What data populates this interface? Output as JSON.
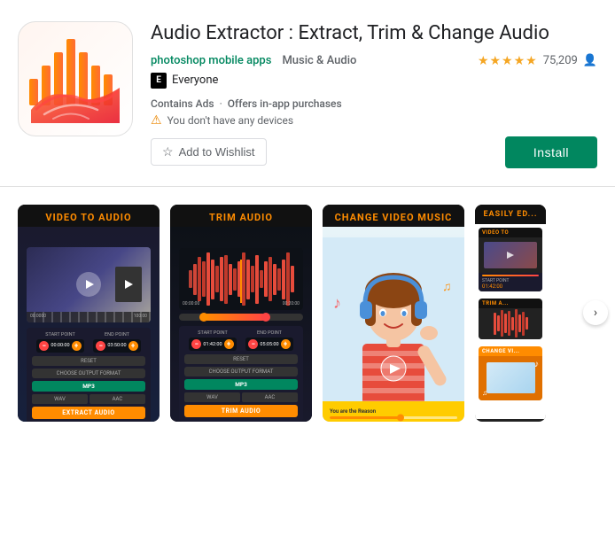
{
  "app": {
    "title": "Audio Extractor : Extract, Trim & Change Audio",
    "developer": "photoshop mobile apps",
    "category": "Music & Audio",
    "rating_stars": "★★★★★",
    "rating_count": "75,209",
    "esrb_rating": "E",
    "esrb_label": "Everyone",
    "contains_ads": "Contains Ads",
    "iap": "Offers in-app purchases",
    "device_warning": "You don't have any devices",
    "wishlist_label": "Add to Wishlist",
    "install_label": "Install"
  },
  "screenshots": [
    {
      "label": "VIDEO TO AUDIO",
      "type": "card1"
    },
    {
      "label": "TRIM AUDIO",
      "type": "card2"
    },
    {
      "label": "CHANGE VIDEO MUSIC",
      "type": "card3"
    },
    {
      "label": "EASILY ED...",
      "type": "card4"
    }
  ],
  "card2": {
    "start_label": "START POINT",
    "end_label": "END POINT",
    "start_time": "01:42:00",
    "end_time": "05:05:00",
    "reset": "RESET",
    "choose_format": "CHOOSE OUTPUT FORMAT",
    "mp3": "MP3",
    "wav": "WAV",
    "aac": "AAC",
    "trim_btn": "TRIM AUDIO"
  },
  "card1": {
    "start_label": "START POINT",
    "end_label": "END POINT",
    "start_time": "00:00:00",
    "end_time": "03:50:00",
    "reset": "RESET",
    "choose_format": "CHOOSE OUTPUT FORMAT",
    "mp3": "MP3",
    "wav": "WAV",
    "aac": "AAC",
    "extract_btn": "EXTRACT AUDIO"
  },
  "card4": {
    "label1": "VIDEO TO",
    "label2": "TRIM A...",
    "label3": "CHANGE VI..."
  },
  "icons": {
    "wishlist": "☆",
    "warning": "⚠",
    "chevron_right": "›",
    "play": "▶",
    "person": "👤"
  }
}
